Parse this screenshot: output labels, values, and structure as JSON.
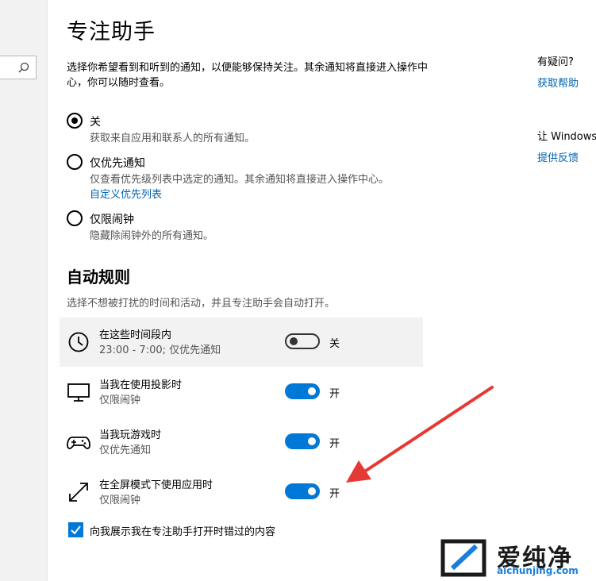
{
  "page": {
    "title": "专注助手",
    "description": "选择你希望看到和听到的通知，以便能够保持关注。其余通知将直接进入操作中心，你可以随时查看。"
  },
  "modes": [
    {
      "label": "关",
      "sub": "获取来自应用和联系人的所有通知。",
      "checked": true
    },
    {
      "label": "仅优先通知",
      "sub": "仅查看优先级列表中选定的通知。其余通知将直接进入操作中心。",
      "link": "自定义优先列表",
      "checked": false
    },
    {
      "label": "仅限闹钟",
      "sub": "隐藏除闹钟外的所有通知。",
      "checked": false
    }
  ],
  "auto_rules": {
    "title": "自动规则",
    "description": "选择不想被打扰的时间和活动，并且专注助手会自动打开。",
    "items": [
      {
        "icon": "clock-icon",
        "title": "在这些时间段内",
        "sub": "23:00 - 7:00; 仅优先通知",
        "state": "关",
        "on": false
      },
      {
        "icon": "monitor-icon",
        "title": "当我在使用投影时",
        "sub": "仅限闹钟",
        "state": "开",
        "on": true
      },
      {
        "icon": "gamepad-icon",
        "title": "当我玩游戏时",
        "sub": "仅优先通知",
        "state": "开",
        "on": true
      },
      {
        "icon": "fullscreen-arrows-icon",
        "title": "在全屏模式下使用应用时",
        "sub": "仅限闹钟",
        "state": "开",
        "on": true
      }
    ],
    "summary_checkbox": {
      "label": "向我展示我在专注助手打开时错过的内容",
      "checked": true
    }
  },
  "sidebar": {
    "question": "有疑问?",
    "help_link": "获取帮助",
    "feedback_text": "让 Windows",
    "feedback_link": "提供反馈"
  },
  "watermark": {
    "text": "爱纯净",
    "url": "aichunjing.com"
  },
  "colors": {
    "accent": "#0078d7",
    "link": "#0063b1",
    "annotation_arrow": "#e53935"
  }
}
